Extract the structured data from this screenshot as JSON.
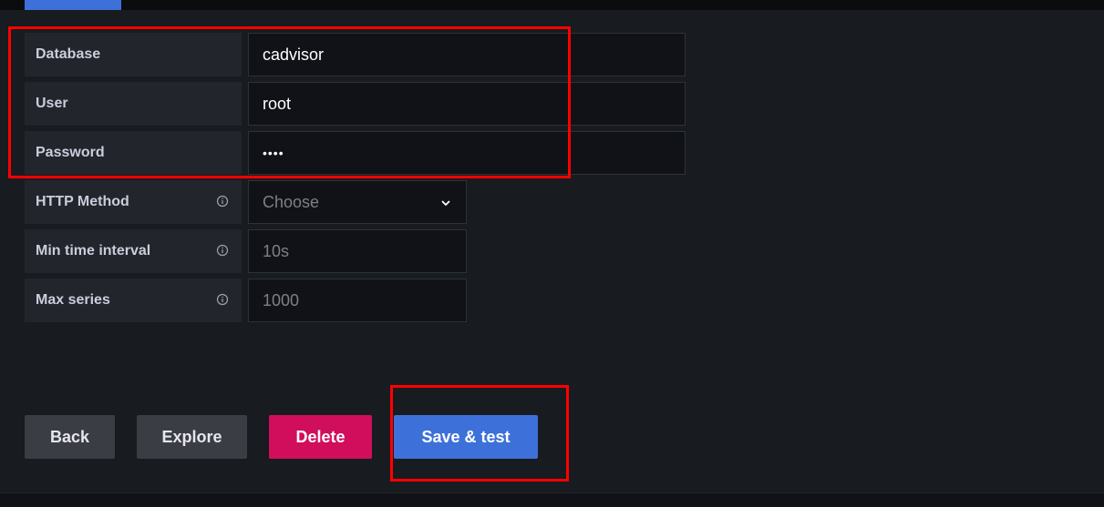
{
  "form": {
    "database": {
      "label": "Database",
      "value": "cadvisor"
    },
    "user": {
      "label": "User",
      "value": "root"
    },
    "password": {
      "label": "Password",
      "value": "••••"
    },
    "http_method": {
      "label": "HTTP Method",
      "placeholder": "Choose",
      "icon": "info-circle-icon"
    },
    "min_time_interval": {
      "label": "Min time interval",
      "placeholder": "10s",
      "icon": "info-circle-icon"
    },
    "max_series": {
      "label": "Max series",
      "placeholder": "1000",
      "icon": "info-circle-icon"
    }
  },
  "actions": {
    "back": "Back",
    "explore": "Explore",
    "delete": "Delete",
    "save_test": "Save & test"
  },
  "colors": {
    "primary": "#3d71d9",
    "destructive": "#d10e5c",
    "secondary": "#3a3d44",
    "annotation": "#ff0000"
  }
}
